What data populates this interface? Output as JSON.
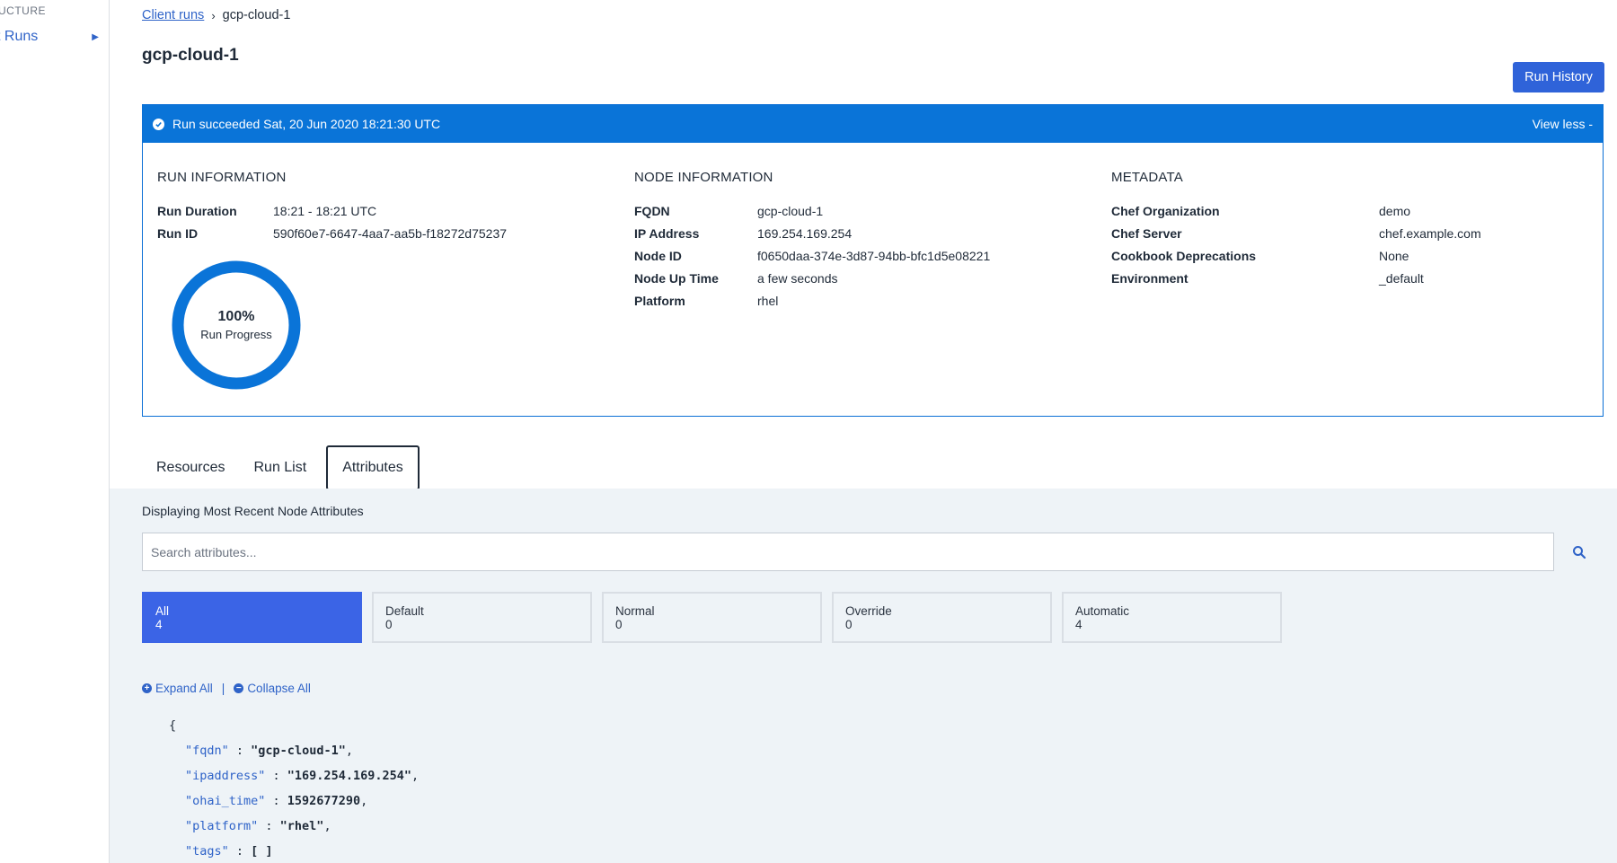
{
  "sidebar": {
    "section_label": "UCTURE",
    "nav_item_label": "t Runs"
  },
  "breadcrumb": {
    "parent": "Client runs",
    "current": "gcp-cloud-1"
  },
  "page": {
    "title": "gcp-cloud-1",
    "run_history_label": "Run History"
  },
  "status": {
    "message": "Run succeeded Sat, 20 Jun 2020 18:21:30 UTC",
    "toggle_label": "View less -",
    "color": "#0a74d8"
  },
  "run_info": {
    "heading": "RUN INFORMATION",
    "rows": [
      {
        "key": "Run Duration",
        "value": "18:21 - 18:21 UTC"
      },
      {
        "key": "Run ID",
        "value": "590f60e7-6647-4aa7-aa5b-f18272d75237"
      }
    ],
    "progress_percent": "100%",
    "progress_value": 100,
    "progress_label": "Run Progress"
  },
  "node_info": {
    "heading": "NODE INFORMATION",
    "rows": [
      {
        "key": "FQDN",
        "value": "gcp-cloud-1"
      },
      {
        "key": "IP Address",
        "value": "169.254.169.254"
      },
      {
        "key": "Node ID",
        "value": "f0650daa-374e-3d87-94bb-bfc1d5e08221"
      },
      {
        "key": "Node Up Time",
        "value": "a few seconds"
      },
      {
        "key": "Platform",
        "value": "rhel"
      }
    ]
  },
  "metadata": {
    "heading": "METADATA",
    "rows": [
      {
        "key": "Chef Organization",
        "value": "demo"
      },
      {
        "key": "Chef Server",
        "value": "chef.example.com"
      },
      {
        "key": "Cookbook Deprecations",
        "value": "None"
      },
      {
        "key": "Environment",
        "value": "_default"
      }
    ]
  },
  "tabs": [
    {
      "label": "Resources"
    },
    {
      "label": "Run List"
    },
    {
      "label": "Attributes"
    }
  ],
  "attributes": {
    "heading": "Displaying Most Recent Node Attributes",
    "search_placeholder": "Search attributes...",
    "filters": [
      {
        "label": "All",
        "count": "4"
      },
      {
        "label": "Default",
        "count": "0"
      },
      {
        "label": "Normal",
        "count": "0"
      },
      {
        "label": "Override",
        "count": "0"
      },
      {
        "label": "Automatic",
        "count": "4"
      }
    ],
    "expand_all": "Expand All",
    "separator": "|",
    "collapse_all": "Collapse All",
    "json": {
      "open": "{",
      "entries": [
        {
          "key": "\"fqdn\"",
          "sep": " : ",
          "value": "\"gcp-cloud-1\"",
          "tail": ","
        },
        {
          "key": "\"ipaddress\"",
          "sep": " : ",
          "value": "\"169.254.169.254\"",
          "tail": ","
        },
        {
          "key": "\"ohai_time\"",
          "sep": " : ",
          "value": "1592677290",
          "tail": ","
        },
        {
          "key": "\"platform\"",
          "sep": " : ",
          "value": "\"rhel\"",
          "tail": ","
        },
        {
          "key": "\"tags\"",
          "sep": " : ",
          "value": "[ ]",
          "tail": ""
        }
      ]
    }
  }
}
